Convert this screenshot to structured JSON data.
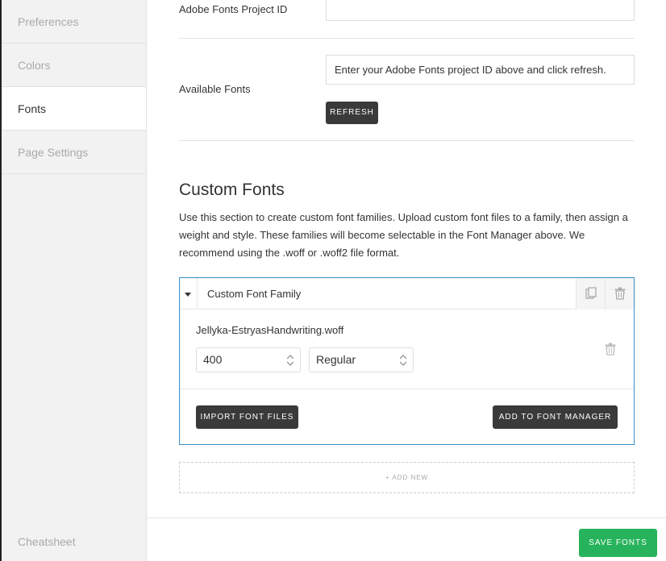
{
  "sidebar": {
    "items": [
      {
        "label": "Preferences",
        "active": false
      },
      {
        "label": "Colors",
        "active": false
      },
      {
        "label": "Fonts",
        "active": true
      },
      {
        "label": "Page Settings",
        "active": false
      }
    ],
    "cheatsheet": "Cheatsheet"
  },
  "adobe": {
    "project_id_label": "Adobe Fonts Project ID",
    "project_id_value": "",
    "available_label": "Available Fonts",
    "available_message": "Enter your Adobe Fonts project ID above and click refresh.",
    "refresh_label": "REFRESH"
  },
  "custom": {
    "title": "Custom Fonts",
    "description": "Use this section to create custom font families. Upload custom font files to a family, then assign a weight and style. These families will become selectable in the Font Manager above. We recommend using the .woff or .woff2 file format.",
    "family": {
      "name": "Custom Font Family",
      "file": "Jellyka-EstryasHandwriting.woff",
      "weight": "400",
      "style": "Regular",
      "import_label": "IMPORT FONT FILES",
      "add_to_manager_label": "ADD TO FONT MANAGER"
    },
    "add_new_label": "+ ADD NEW"
  },
  "footer": {
    "save_label": "SAVE FONTS"
  },
  "colors": {
    "accent_border": "#3a8dc4",
    "save_green": "#27b35b",
    "dark_button": "#3a3a3a"
  },
  "icons": [
    "caret-down-icon",
    "copy-icon",
    "trash-icon",
    "stepper-arrows-icon"
  ]
}
